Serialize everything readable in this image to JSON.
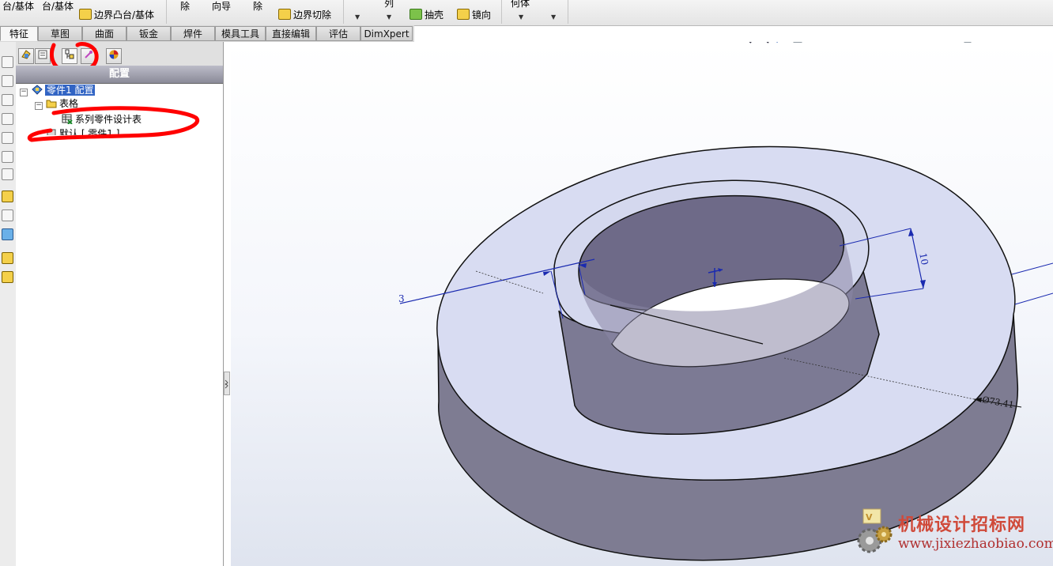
{
  "ribbon": {
    "items": [
      {
        "label": "台/基体"
      },
      {
        "label": "台/基体"
      },
      {
        "label": "边界凸台/基体"
      },
      {
        "label": "除"
      },
      {
        "label": "向导"
      },
      {
        "label": "除"
      },
      {
        "label": "边界切除"
      },
      {
        "label": "列"
      },
      {
        "label": "抽壳"
      },
      {
        "label": "镜向"
      },
      {
        "label": "何体"
      }
    ]
  },
  "tabs": [
    {
      "label": "特征"
    },
    {
      "label": "草图"
    },
    {
      "label": "曲面"
    },
    {
      "label": "钣金"
    },
    {
      "label": "焊件"
    },
    {
      "label": "模具工具"
    },
    {
      "label": "直接编辑"
    },
    {
      "label": "评估"
    },
    {
      "label": "DimXpert"
    }
  ],
  "panel": {
    "header": "配置",
    "tree": {
      "root_label": "零件1 配置",
      "folder_label": "表格",
      "design_table_label": "系列零件设计表",
      "default_config_label": "默认 [ 零件1 ]"
    }
  },
  "dimensions": {
    "d1": "3",
    "d2": "10",
    "d3": "Ø73.41"
  },
  "watermark": {
    "name": "机械设计招标网",
    "url": "www.jixiezhaobiao.com"
  },
  "colors": {
    "model_face": "#d7dcf2",
    "model_side": "#7a7890",
    "dimension": "#1a2ab0",
    "annotation": "#ff0000",
    "selection": "#3164c4"
  }
}
